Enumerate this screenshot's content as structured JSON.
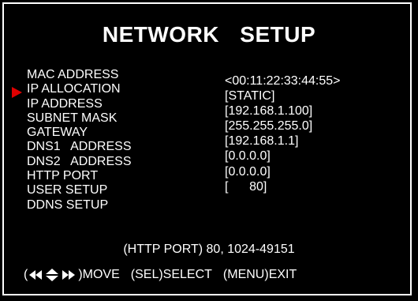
{
  "title": "NETWORK   SETUP",
  "menu": [
    {
      "label": "MAC ADDRESS",
      "value": "<00:11:22:33:44:55>"
    },
    {
      "label": "IP ALLOCATION",
      "value": "[STATIC]"
    },
    {
      "label": "IP ADDRESS",
      "value": "[192.168.1.100]"
    },
    {
      "label": "SUBNET MASK",
      "value": "[255.255.255.0]"
    },
    {
      "label": "GATEWAY",
      "value": "[192.168.1.1]"
    },
    {
      "label": "DNS1   ADDRESS",
      "value": "[0.0.0.0]"
    },
    {
      "label": "DNS2   ADDRESS",
      "value": "[0.0.0.0]"
    },
    {
      "label": "HTTP PORT",
      "value": "[      80]"
    },
    {
      "label": "USER SETUP"
    },
    {
      "label": "DDNS SETUP"
    }
  ],
  "selected_index": 1,
  "cursor_color": "#e00000",
  "hint": "(HTTP PORT) 80, 1024-49151",
  "footer": {
    "open_paren": "(",
    "move": ")MOVE",
    "select": "(SEL)SELECT",
    "exit": "(MENU)EXIT"
  }
}
